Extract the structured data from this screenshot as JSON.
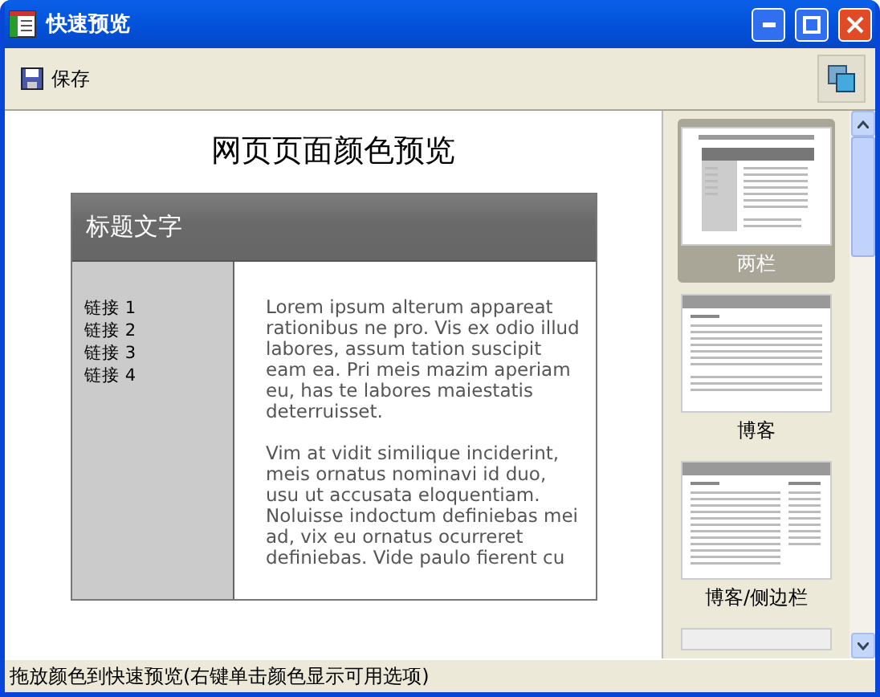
{
  "window": {
    "title": "快速预览"
  },
  "toolbar": {
    "save_label": "保存"
  },
  "preview": {
    "title": "网页页面颜色预览",
    "header": "标题文字",
    "links": [
      "链接 1",
      "链接 2",
      "链接 3",
      "链接 4"
    ],
    "paragraphs": [
      "Lorem ipsum alterum appareat rationibus ne pro. Vis ex odio illud labores, assum tation suscipit eam ea. Pri meis mazim aperiam eu, has te labores maiestatis deterruisset.",
      "Vim at vidit similique inciderint, meis ornatus nominavi id duo, usu ut accusata eloquentiam. Noluisse indoctum definiebas mei ad, vix eu ornatus ocurreret definiebas. Vide paulo fierent cu"
    ]
  },
  "templates": [
    {
      "kind": "two-column",
      "label": "两栏",
      "selected": true
    },
    {
      "kind": "blog",
      "label": "博客",
      "selected": false
    },
    {
      "kind": "blog-sidebar",
      "label": "博客/侧边栏",
      "selected": false
    },
    {
      "kind": "partial",
      "selected": false
    }
  ],
  "status_bar": {
    "text": "拖放颜色到快速预览(右键单击颜色显示可用选项)"
  }
}
